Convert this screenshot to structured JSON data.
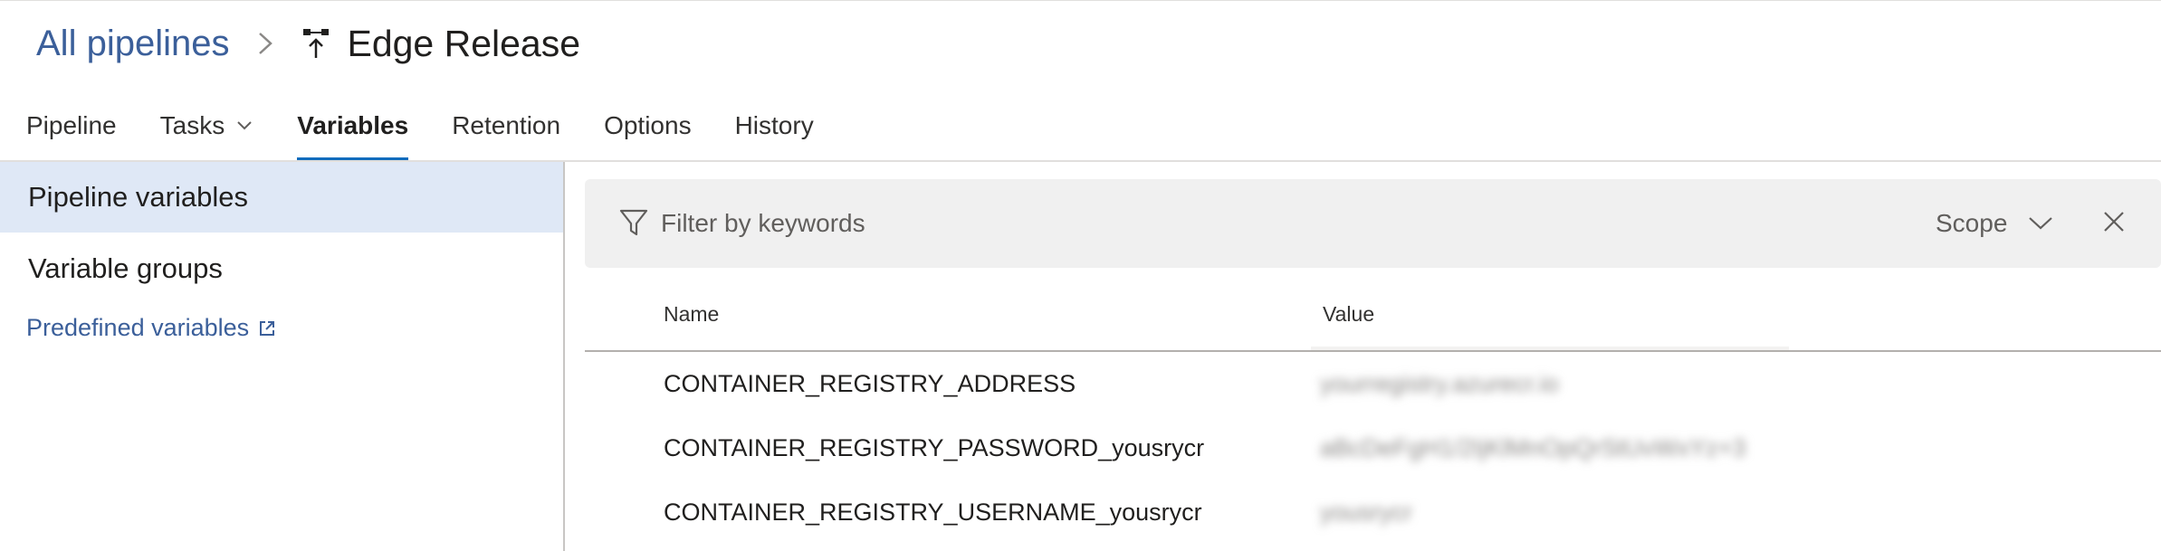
{
  "breadcrumb": {
    "parent_label": "All pipelines",
    "separator_icon": "chevron-right-icon",
    "pipeline_icon": "release-pipeline-icon",
    "title": "Edge Release"
  },
  "tabs": [
    {
      "label": "Pipeline",
      "active": false
    },
    {
      "label": "Tasks",
      "active": false,
      "has_dropdown": true
    },
    {
      "label": "Variables",
      "active": true
    },
    {
      "label": "Retention",
      "active": false
    },
    {
      "label": "Options",
      "active": false
    },
    {
      "label": "History",
      "active": false
    }
  ],
  "sidebar": {
    "items": [
      {
        "label": "Pipeline variables",
        "selected": true
      },
      {
        "label": "Variable groups",
        "selected": false
      }
    ],
    "predefined_link": {
      "label": "Predefined variables",
      "icon": "external-link-icon"
    }
  },
  "filter": {
    "placeholder": "Filter by keywords",
    "scope_label": "Scope",
    "icons": {
      "filter": "filter-icon",
      "scope": "chevron-down-icon",
      "close": "close-icon"
    }
  },
  "table": {
    "headers": {
      "name": "Name",
      "value": "Value"
    },
    "rows": [
      {
        "name": "CONTAINER_REGISTRY_ADDRESS",
        "value": "yourregistry.azurecr.io"
      },
      {
        "name": "CONTAINER_REGISTRY_PASSWORD_yousrycr",
        "value": "aBcDeFgH1/2IjKlMnOpQrStUvWxYz+3"
      },
      {
        "name": "CONTAINER_REGISTRY_USERNAME_yousrycr",
        "value": "yousrycr"
      }
    ],
    "values_blurred": true
  },
  "colors": {
    "link": "#3b5f9a",
    "accent": "#0f6cbd",
    "selected_bg": "#dfe8f6",
    "filter_bg": "#f0f0f0"
  }
}
